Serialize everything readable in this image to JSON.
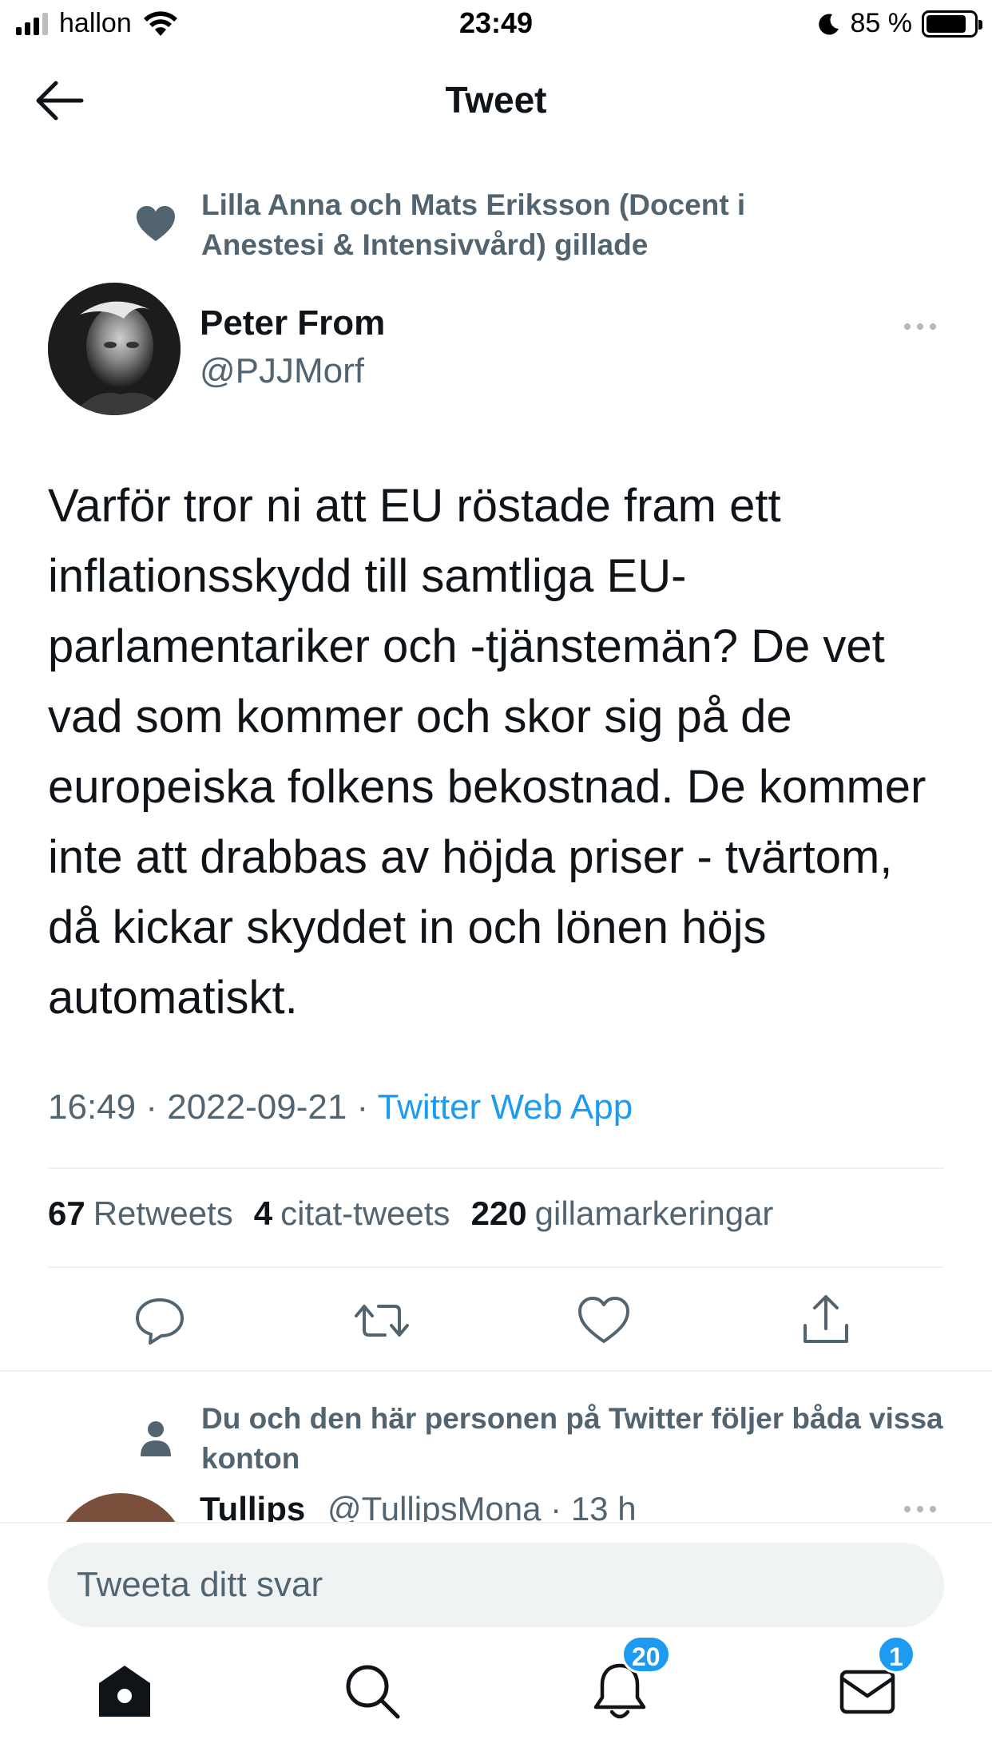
{
  "status_bar": {
    "carrier": "hallon",
    "time": "23:49",
    "battery_percent": "85 %",
    "battery_level": 0.85
  },
  "header": {
    "title": "Tweet",
    "back_icon": "arrow-left-icon"
  },
  "social_context": {
    "icon": "heart-icon",
    "text": "Lilla Anna och Mats Eriksson (Docent i Anestesi & Intensivvård) gillade"
  },
  "tweet": {
    "author_name": "Peter From",
    "author_handle": "@PJJMorf",
    "text": "Varför tror ni att EU röstade fram ett inflationsskydd till samtliga EU-parlamentariker och -tjänstemän? De vet vad som kommer och skor sig på de europeiska folkens bekostnad. De kommer inte att drabbas av höjda priser - tvärtom, då kickar skyddet in och lönen höjs automatiskt.",
    "time": "16:49",
    "date": "2022-09-21",
    "separator": "·",
    "source": "Twitter Web App",
    "retweets_count": "67",
    "retweets_label": "Retweets",
    "quotes_count": "4",
    "quotes_label": "citat-tweets",
    "likes_count": "220",
    "likes_label": "gillamarkeringar"
  },
  "actions": [
    "reply-icon",
    "retweet-icon",
    "like-icon",
    "share-icon"
  ],
  "reply_preview": {
    "context_icon": "person-icon",
    "context_text": "Du och den här personen på Twitter följer båda vissa konton",
    "name": "Tullips",
    "handle": "@TullipsMona · 13 h"
  },
  "compose": {
    "placeholder": "Tweeta ditt svar"
  },
  "tabbar": {
    "notifications_badge": "20",
    "messages_badge": "1"
  },
  "colors": {
    "accent": "#1d9bf0",
    "secondary_text": "#536471",
    "primary_text": "#0f1419"
  }
}
